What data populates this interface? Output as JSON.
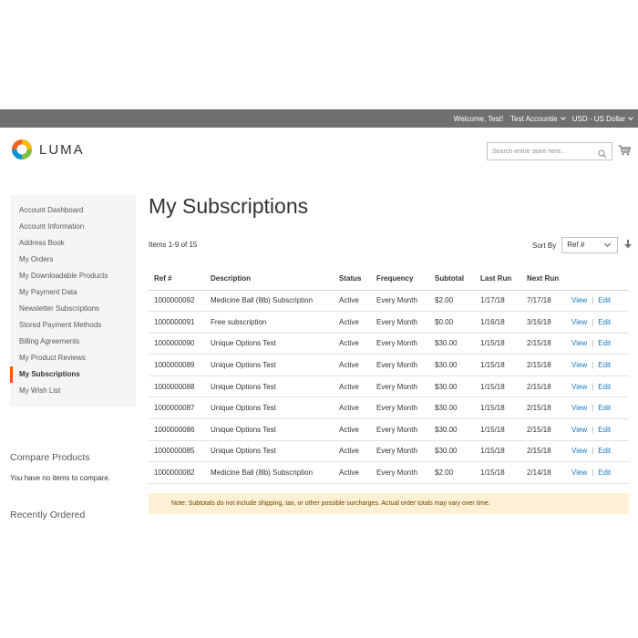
{
  "topbar": {
    "welcome": "Welcome, Test!",
    "account": "Test Accountie",
    "currency": "USD - US Dollar"
  },
  "header": {
    "logo_text": "LUMA",
    "search_placeholder": "Search entire store here...",
    "search_icon": "search-icon",
    "cart_icon": "cart-icon"
  },
  "sidebar": {
    "items": [
      {
        "label": "Account Dashboard"
      },
      {
        "label": "Account Information"
      },
      {
        "label": "Address Book"
      },
      {
        "label": "My Orders"
      },
      {
        "label": "My Downloadable Products"
      },
      {
        "label": "My Payment Data"
      },
      {
        "label": "Newsletter Subscriptions"
      },
      {
        "label": "Stored Payment Methods"
      },
      {
        "label": "Billing Agreements"
      },
      {
        "label": "My Product Reviews"
      },
      {
        "label": "My Subscriptions",
        "active": true
      },
      {
        "label": "My Wish List"
      }
    ],
    "compare_title": "Compare Products",
    "compare_text": "You have no items to compare.",
    "recent_title": "Recently Ordered"
  },
  "main": {
    "title": "My Subscriptions",
    "items_count": "Items 1-9 of 15",
    "sort_label": "Sort By",
    "sort_value": "Ref #",
    "columns": [
      "Ref #",
      "Description",
      "Status",
      "Frequency",
      "Subtotal",
      "Last Run",
      "Next Run"
    ],
    "rows": [
      {
        "ref": "1000000092",
        "description": "Medicine Ball (8lb) Subscription",
        "status": "Active",
        "frequency": "Every Month",
        "subtotal": "$2.00",
        "last_run": "1/17/18",
        "next_run": "7/17/18"
      },
      {
        "ref": "1000000091",
        "description": "Free subscription",
        "status": "Active",
        "frequency": "Every Month",
        "subtotal": "$0.00",
        "last_run": "1/16/18",
        "next_run": "3/16/18"
      },
      {
        "ref": "1000000090",
        "description": "Unique Options Test",
        "status": "Active",
        "frequency": "Every Month",
        "subtotal": "$30.00",
        "last_run": "1/15/18",
        "next_run": "2/15/18"
      },
      {
        "ref": "1000000089",
        "description": "Unique Options Test",
        "status": "Active",
        "frequency": "Every Month",
        "subtotal": "$30.00",
        "last_run": "1/15/18",
        "next_run": "2/15/18"
      },
      {
        "ref": "1000000088",
        "description": "Unique Options Test",
        "status": "Active",
        "frequency": "Every Month",
        "subtotal": "$30.00",
        "last_run": "1/15/18",
        "next_run": "2/15/18"
      },
      {
        "ref": "1000000087",
        "description": "Unique Options Test",
        "status": "Active",
        "frequency": "Every Month",
        "subtotal": "$30.00",
        "last_run": "1/15/18",
        "next_run": "2/15/18"
      },
      {
        "ref": "1000000086",
        "description": "Unique Options Test",
        "status": "Active",
        "frequency": "Every Month",
        "subtotal": "$30.00",
        "last_run": "1/15/18",
        "next_run": "2/15/18"
      },
      {
        "ref": "1000000085",
        "description": "Unique Options Test",
        "status": "Active",
        "frequency": "Every Month",
        "subtotal": "$30.00",
        "last_run": "1/15/18",
        "next_run": "2/15/18"
      },
      {
        "ref": "1000000082",
        "description": "Medicine Ball (8lb) Subscription",
        "status": "Active",
        "frequency": "Every Month",
        "subtotal": "$2.00",
        "last_run": "1/15/18",
        "next_run": "2/14/18"
      }
    ],
    "view_label": "View",
    "edit_label": "Edit",
    "note": "Note: Subtotals do not include shipping, tax, or other possible surcharges. Actual order totals may vary over time."
  },
  "colors": {
    "topbar": "#6e716e",
    "link": "#1979c3",
    "active_marker": "#ff5501",
    "note_bg": "#fdf0d5"
  }
}
